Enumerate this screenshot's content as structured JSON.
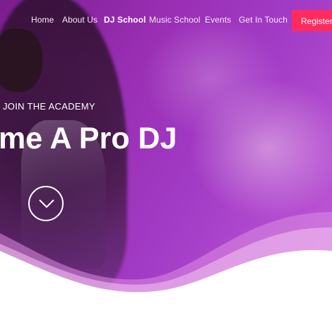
{
  "nav": {
    "items": [
      {
        "label": "Home",
        "active": false
      },
      {
        "label": "About Us",
        "active": false
      },
      {
        "label": "DJ School",
        "active": true
      },
      {
        "label": "Music School",
        "active": false
      },
      {
        "label": "Events",
        "active": false
      },
      {
        "label": "Get In Touch",
        "active": false
      }
    ],
    "register_label": "Register"
  },
  "hero": {
    "kicker": "JOIN THE ACADEMY",
    "headline": "me A Pro DJ",
    "scroll_icon": "chevron-down-icon"
  },
  "colors": {
    "accent": "#ff2b5e",
    "hero_purple": "#9a2fb4",
    "text": "#ffffff"
  }
}
